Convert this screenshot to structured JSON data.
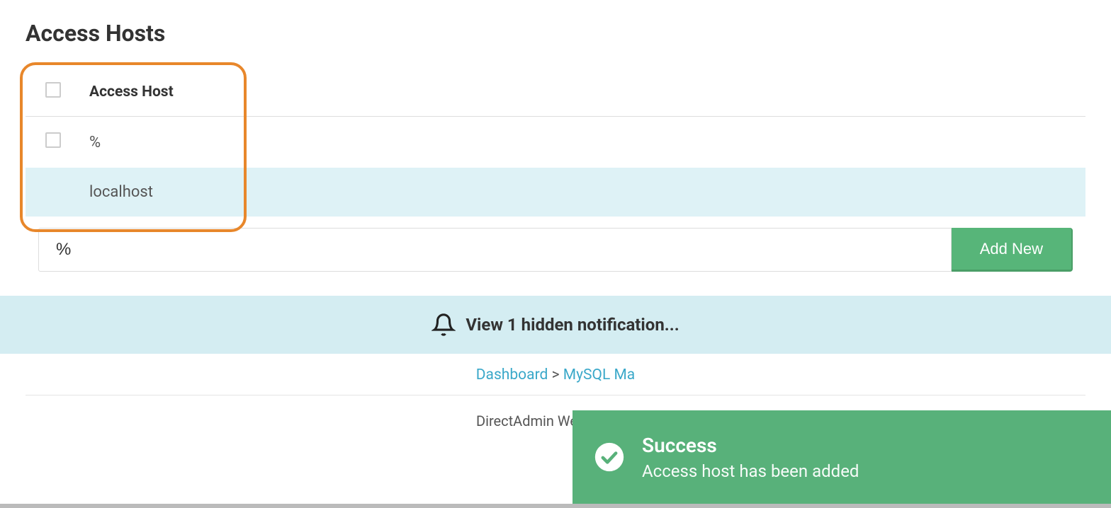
{
  "page": {
    "title": "Access Hosts"
  },
  "table": {
    "header": "Access Host",
    "rows": [
      {
        "value": "%",
        "selected": false,
        "showCheckbox": true
      },
      {
        "value": "localhost",
        "selected": true,
        "showCheckbox": false
      }
    ]
  },
  "addForm": {
    "inputValue": "%",
    "buttonLabel": "Add New"
  },
  "notificationBar": {
    "text": "View 1 hidden notification..."
  },
  "breadcrumb": {
    "items": [
      {
        "label": "Dashboard",
        "link": true
      },
      {
        "label": "MySQL Ma",
        "link": true
      }
    ],
    "separator": ">"
  },
  "footer": {
    "text": "DirectAdmin Web Control"
  },
  "toast": {
    "title": "Success",
    "message": "Access host has been added"
  }
}
